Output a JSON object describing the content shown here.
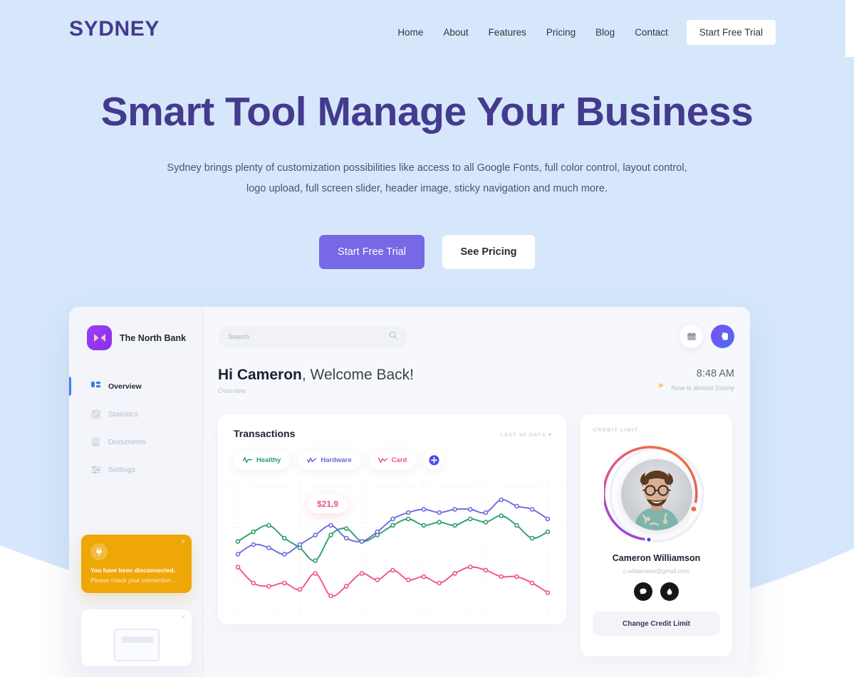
{
  "theme": {
    "hero_bg": "#d6e7fb",
    "brand_color": "#443a8e",
    "primary_button": "#7768e5",
    "dash_bg": "#f7f8fc",
    "accent_green": "#2e9e6b",
    "accent_blue": "#6a6ae0",
    "accent_pink": "#ef557c",
    "alert_orange": "#efa708"
  },
  "header": {
    "brand": "SYDNEY",
    "nav": [
      {
        "label": "Home",
        "name": "nav-home"
      },
      {
        "label": "About",
        "name": "nav-about"
      },
      {
        "label": "Features",
        "name": "nav-features"
      },
      {
        "label": "Pricing",
        "name": "nav-pricing"
      },
      {
        "label": "Blog",
        "name": "nav-blog"
      },
      {
        "label": "Contact",
        "name": "nav-contact"
      }
    ],
    "cta_label": "Start Free Trial"
  },
  "hero": {
    "title": "Smart Tool Manage Your Business",
    "subtitle_line1": "Sydney brings plenty of customization possibilities like access to all Google Fonts, full color control, layout control,",
    "subtitle_line2": "logo upload, full screen slider, header image, sticky navigation and much more.",
    "primary_cta": "Start Free Trial",
    "secondary_cta": "See Pricing"
  },
  "dashboard": {
    "brand_name": "The North Bank",
    "logo_icon": "bowtie-icon",
    "search": {
      "placeholder": "Search",
      "value": "",
      "icon": "search-icon"
    },
    "topbar_icons": [
      {
        "name": "calendar-icon"
      },
      {
        "name": "analytics-icon"
      }
    ],
    "sidebar": [
      {
        "label": "Overview",
        "icon": "grid-icon",
        "active": true
      },
      {
        "label": "Statistics",
        "icon": "chart-square-icon",
        "active": false
      },
      {
        "label": "Documents",
        "icon": "document-icon",
        "active": false
      },
      {
        "label": "Settings",
        "icon": "sliders-icon",
        "active": false
      }
    ],
    "greeting": {
      "bold_part": "Hi Cameron",
      "rest_part": ", Welcome Back!",
      "subtitle": "Overview"
    },
    "clock": {
      "time": "8:48 AM",
      "weather": "Now is almost Sunny",
      "weather_icon": "sun-cloud-icon"
    },
    "transactions": {
      "title": "Transactions",
      "range_label": "LAST 90 DAYS",
      "range_caret": "▾",
      "chips": [
        {
          "label": "Healthy",
          "color": "#2e9e6b"
        },
        {
          "label": "Hardware",
          "color": "#6a6ae0"
        },
        {
          "label": "Card",
          "color": "#ef557c"
        }
      ],
      "add_button_icon": "plus-icon",
      "tooltip_value": "$21,9"
    },
    "credit": {
      "label": "CREDIT LIMIT",
      "name": "Cameron Williamson",
      "email": "c.williamson@gmail.com",
      "actions": [
        {
          "name": "message-icon"
        },
        {
          "name": "share-icon"
        }
      ],
      "change_button": "Change Credit Limit",
      "ring_start_color": "#7a3ff0",
      "ring_end_color": "#f0703c"
    },
    "toast": {
      "title": "You have been disconnected.",
      "body": "Please check your connection...",
      "close_icon": "close-icon",
      "alert_icon": "plug-icon"
    },
    "mini_card": {
      "close_icon": "close-icon",
      "placeholder_icon": "image-placeholder-icon"
    }
  },
  "chart_data": {
    "type": "line",
    "title": "Transactions",
    "xlabel": "",
    "ylabel": "",
    "grid": "dotted",
    "legend_position": "top-left",
    "x": [
      0,
      1,
      2,
      3,
      4,
      5,
      6,
      7,
      8,
      9,
      10,
      11,
      12,
      13,
      14,
      15,
      16,
      17,
      18,
      19,
      20
    ],
    "series": [
      {
        "name": "Healthy",
        "color": "#2e9e6b",
        "values": [
          52,
          58,
          62,
          54,
          48,
          40,
          56,
          60,
          52,
          56,
          62,
          66,
          62,
          64,
          62,
          66,
          64,
          68,
          62,
          54,
          58
        ]
      },
      {
        "name": "Hardware",
        "color": "#6a6ae0",
        "values": [
          44,
          50,
          48,
          44,
          50,
          56,
          62,
          54,
          52,
          58,
          66,
          70,
          72,
          70,
          72,
          72,
          70,
          78,
          74,
          72,
          66
        ]
      },
      {
        "name": "Card",
        "color": "#ef557c",
        "values": [
          36,
          26,
          24,
          26,
          22,
          32,
          18,
          24,
          32,
          28,
          34,
          28,
          30,
          26,
          32,
          36,
          34,
          30,
          30,
          26,
          20
        ]
      }
    ],
    "annotations": [
      {
        "label": "$21,9",
        "x": 5,
        "y": 30,
        "color": "#ef557c"
      }
    ]
  }
}
